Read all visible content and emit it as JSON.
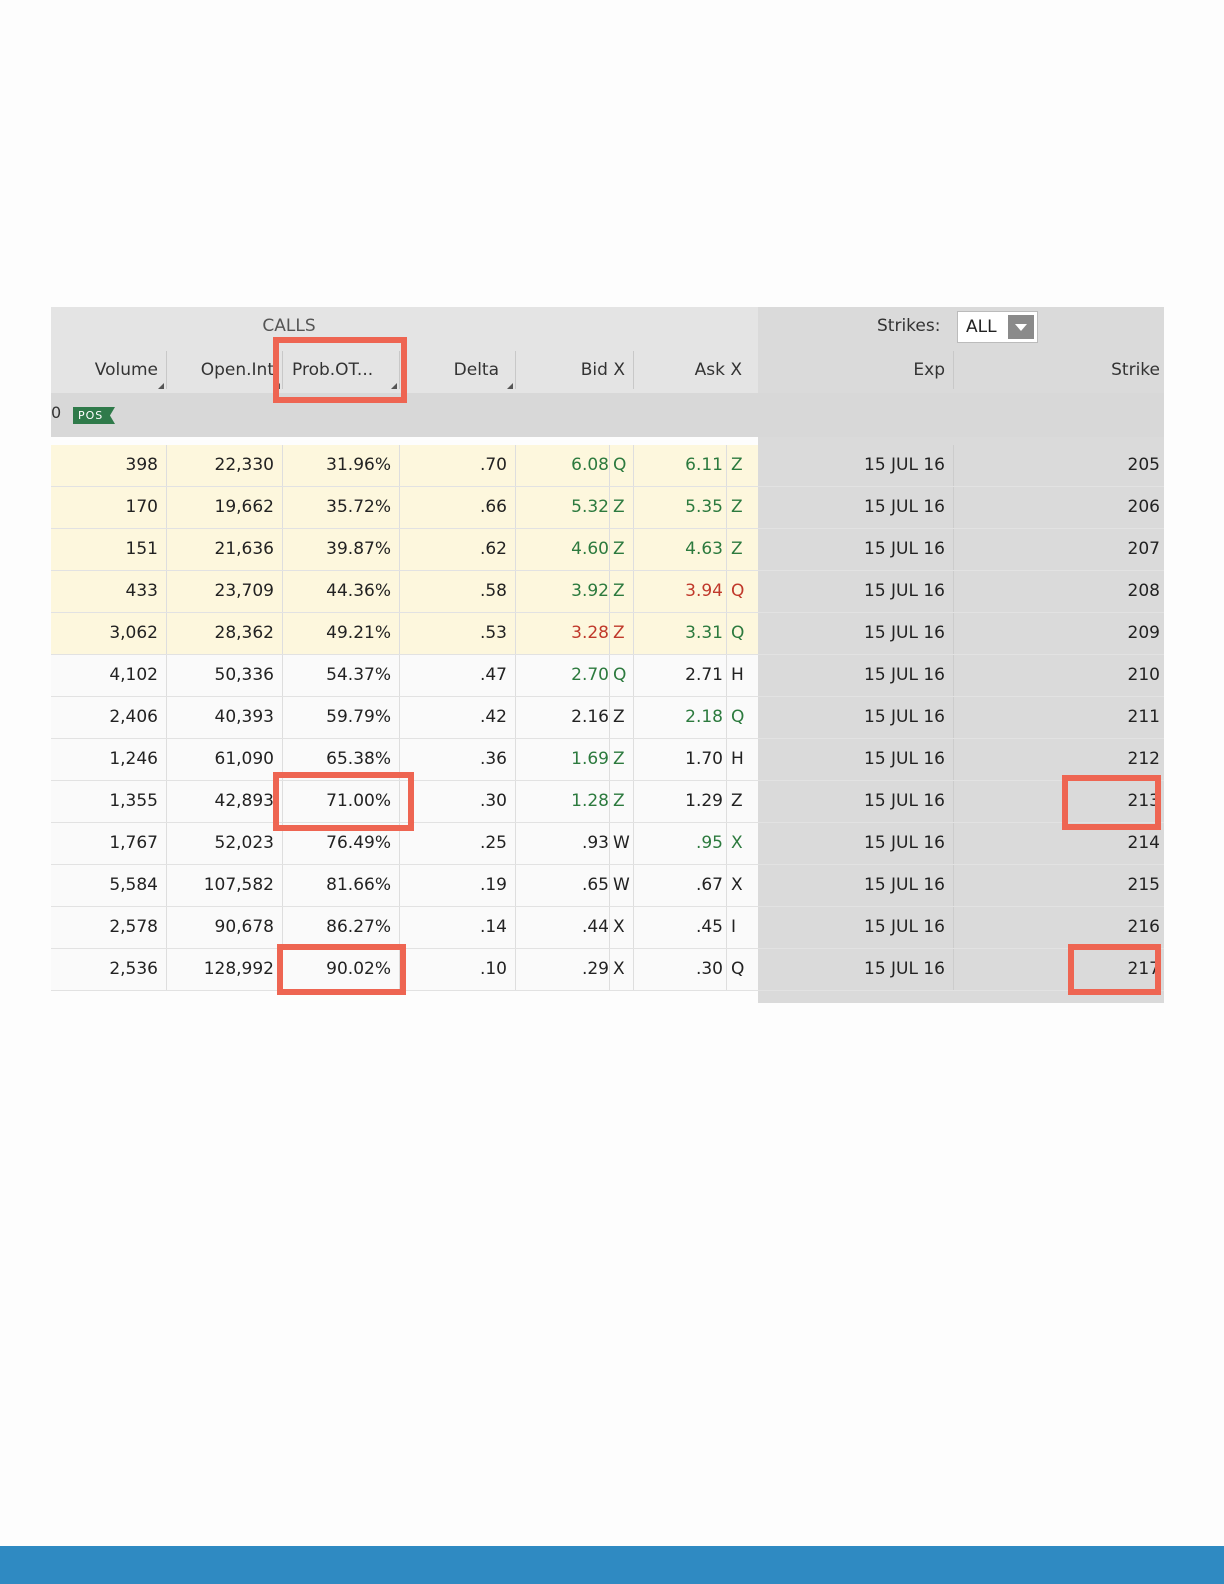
{
  "header": {
    "calls_title": "CALLS",
    "strikes_label": "Strikes:",
    "strikes_value": "ALL",
    "columns": [
      "Volume",
      "Open.Int",
      "Prob.OT...",
      "Delta",
      "Bid X",
      "Ask X",
      "Exp",
      "Strike"
    ]
  },
  "position_row": {
    "prefix": "0",
    "badge": "POS"
  },
  "rows": [
    {
      "moneyness": "itm",
      "volume": "398",
      "open_int": "22,330",
      "prob_otm": "31.96%",
      "delta": ".70",
      "bid": "6.08",
      "bid_exch": "Q",
      "ask": "6.11",
      "ask_exch": "Z",
      "exp": "15 JUL 16",
      "strike": "205",
      "bid_color": "green",
      "ask_color": "green"
    },
    {
      "moneyness": "itm",
      "volume": "170",
      "open_int": "19,662",
      "prob_otm": "35.72%",
      "delta": ".66",
      "bid": "5.32",
      "bid_exch": "Z",
      "ask": "5.35",
      "ask_exch": "Z",
      "exp": "15 JUL 16",
      "strike": "206",
      "bid_color": "green",
      "ask_color": "green"
    },
    {
      "moneyness": "itm",
      "volume": "151",
      "open_int": "21,636",
      "prob_otm": "39.87%",
      "delta": ".62",
      "bid": "4.60",
      "bid_exch": "Z",
      "ask": "4.63",
      "ask_exch": "Z",
      "exp": "15 JUL 16",
      "strike": "207",
      "bid_color": "green",
      "ask_color": "green"
    },
    {
      "moneyness": "itm",
      "volume": "433",
      "open_int": "23,709",
      "prob_otm": "44.36%",
      "delta": ".58",
      "bid": "3.92",
      "bid_exch": "Z",
      "ask": "3.94",
      "ask_exch": "Q",
      "exp": "15 JUL 16",
      "strike": "208",
      "bid_color": "green",
      "ask_color": "red"
    },
    {
      "moneyness": "itm",
      "volume": "3,062",
      "open_int": "28,362",
      "prob_otm": "49.21%",
      "delta": ".53",
      "bid": "3.28",
      "bid_exch": "Z",
      "ask": "3.31",
      "ask_exch": "Q",
      "exp": "15 JUL 16",
      "strike": "209",
      "bid_color": "red",
      "ask_color": "green"
    },
    {
      "moneyness": "otm",
      "volume": "4,102",
      "open_int": "50,336",
      "prob_otm": "54.37%",
      "delta": ".47",
      "bid": "2.70",
      "bid_exch": "Q",
      "ask": "2.71",
      "ask_exch": "H",
      "exp": "15 JUL 16",
      "strike": "210",
      "bid_color": "green",
      "ask_color": "black"
    },
    {
      "moneyness": "otm",
      "volume": "2,406",
      "open_int": "40,393",
      "prob_otm": "59.79%",
      "delta": ".42",
      "bid": "2.16",
      "bid_exch": "Z",
      "ask": "2.18",
      "ask_exch": "Q",
      "exp": "15 JUL 16",
      "strike": "211",
      "bid_color": "black",
      "ask_color": "green"
    },
    {
      "moneyness": "otm",
      "volume": "1,246",
      "open_int": "61,090",
      "prob_otm": "65.38%",
      "delta": ".36",
      "bid": "1.69",
      "bid_exch": "Z",
      "ask": "1.70",
      "ask_exch": "H",
      "exp": "15 JUL 16",
      "strike": "212",
      "bid_color": "green",
      "ask_color": "black"
    },
    {
      "moneyness": "otm",
      "volume": "1,355",
      "open_int": "42,893",
      "prob_otm": "71.00%",
      "delta": ".30",
      "bid": "1.28",
      "bid_exch": "Z",
      "ask": "1.29",
      "ask_exch": "Z",
      "exp": "15 JUL 16",
      "strike": "213",
      "bid_color": "green",
      "ask_color": "black"
    },
    {
      "moneyness": "otm",
      "volume": "1,767",
      "open_int": "52,023",
      "prob_otm": "76.49%",
      "delta": ".25",
      "bid": ".93",
      "bid_exch": "W",
      "ask": ".95",
      "ask_exch": "X",
      "exp": "15 JUL 16",
      "strike": "214",
      "bid_color": "black",
      "ask_color": "green"
    },
    {
      "moneyness": "otm",
      "volume": "5,584",
      "open_int": "107,582",
      "prob_otm": "81.66%",
      "delta": ".19",
      "bid": ".65",
      "bid_exch": "W",
      "ask": ".67",
      "ask_exch": "X",
      "exp": "15 JUL 16",
      "strike": "215",
      "bid_color": "black",
      "ask_color": "black"
    },
    {
      "moneyness": "otm",
      "volume": "2,578",
      "open_int": "90,678",
      "prob_otm": "86.27%",
      "delta": ".14",
      "bid": ".44",
      "bid_exch": "X",
      "ask": ".45",
      "ask_exch": "I",
      "exp": "15 JUL 16",
      "strike": "216",
      "bid_color": "black",
      "ask_color": "black"
    },
    {
      "moneyness": "otm",
      "volume": "2,536",
      "open_int": "128,992",
      "prob_otm": "90.02%",
      "delta": ".10",
      "bid": ".29",
      "bid_exch": "X",
      "ask": ".30",
      "ask_exch": "Q",
      "exp": "15 JUL 16",
      "strike": "217",
      "bid_color": "black",
      "ask_color": "black"
    }
  ],
  "colors": {
    "highlight": "#ee6552",
    "itm_background": "#fdf7dd",
    "footer": "#2f8ac2",
    "green": "#2c7a3e",
    "red": "#c0392b"
  }
}
